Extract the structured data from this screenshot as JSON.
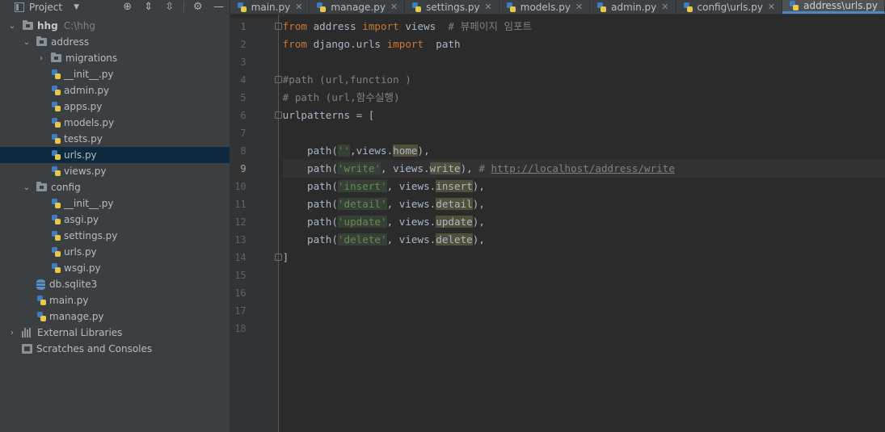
{
  "project_panel": {
    "title": "Project",
    "root": {
      "name": "hhg",
      "path": "C:\\hhg"
    },
    "tree": [
      {
        "label": "address",
        "kind": "folder",
        "depth": 1,
        "expanded": true
      },
      {
        "label": "migrations",
        "kind": "folder",
        "depth": 2,
        "expanded": false
      },
      {
        "label": "__init__.py",
        "kind": "py",
        "depth": 2
      },
      {
        "label": "admin.py",
        "kind": "py",
        "depth": 2
      },
      {
        "label": "apps.py",
        "kind": "py",
        "depth": 2
      },
      {
        "label": "models.py",
        "kind": "py",
        "depth": 2
      },
      {
        "label": "tests.py",
        "kind": "py",
        "depth": 2
      },
      {
        "label": "urls.py",
        "kind": "py",
        "depth": 2,
        "selected": true
      },
      {
        "label": "views.py",
        "kind": "py",
        "depth": 2
      },
      {
        "label": "config",
        "kind": "folder",
        "depth": 1,
        "expanded": true
      },
      {
        "label": "__init__.py",
        "kind": "py",
        "depth": 2
      },
      {
        "label": "asgi.py",
        "kind": "py",
        "depth": 2
      },
      {
        "label": "settings.py",
        "kind": "py",
        "depth": 2
      },
      {
        "label": "urls.py",
        "kind": "py",
        "depth": 2
      },
      {
        "label": "wsgi.py",
        "kind": "py",
        "depth": 2
      },
      {
        "label": "db.sqlite3",
        "kind": "db",
        "depth": 1
      },
      {
        "label": "main.py",
        "kind": "py",
        "depth": 1
      },
      {
        "label": "manage.py",
        "kind": "py",
        "depth": 1
      }
    ],
    "external_libraries": "External Libraries",
    "scratches": "Scratches and Consoles"
  },
  "tabs": [
    {
      "label": "main.py",
      "active": false
    },
    {
      "label": "manage.py",
      "active": false
    },
    {
      "label": "settings.py",
      "active": false
    },
    {
      "label": "models.py",
      "active": false
    },
    {
      "label": "admin.py",
      "active": false
    },
    {
      "label": "config\\urls.py",
      "active": false
    },
    {
      "label": "address\\urls.py",
      "active": true
    }
  ],
  "editor": {
    "current_line": 9,
    "line_numbers": [
      "1",
      "2",
      "3",
      "4",
      "5",
      "6",
      "7",
      "8",
      "9",
      "10",
      "11",
      "12",
      "13",
      "14",
      "15",
      "16",
      "17",
      "18"
    ],
    "lines": [
      [
        "from",
        " address ",
        "import",
        " views  ",
        "# 뷰페이지 임포트"
      ],
      [
        "from",
        " django.urls ",
        "import",
        "  path"
      ],
      [],
      [
        "#path (url,function )"
      ],
      [
        "# path (url,함수실행)"
      ],
      [
        "urlpatterns = ["
      ],
      [],
      [
        "    path(",
        "''",
        ",views.",
        "home",
        "),"
      ],
      [
        "    path(",
        "'write'",
        ", views.",
        "write",
        "), ",
        "# ",
        "http://localhost/address/write"
      ],
      [
        "    path(",
        "'insert'",
        ", views.",
        "insert",
        "),"
      ],
      [
        "    path(",
        "'detail'",
        ", views.",
        "detail",
        "),"
      ],
      [
        "    path(",
        "'update'",
        ", views.",
        "update",
        "),"
      ],
      [
        "    path(",
        "'delete'",
        ", views.",
        "delete",
        "),"
      ],
      [
        "]"
      ]
    ]
  }
}
